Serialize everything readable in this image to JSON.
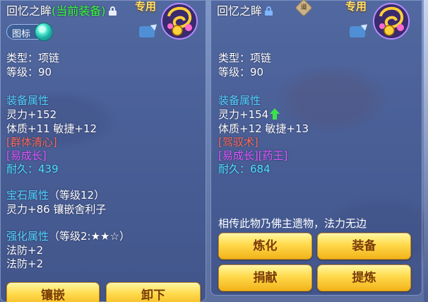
{
  "left": {
    "name": "回忆之眸",
    "current_tag": "(当前装备)",
    "exclusive": "专用",
    "icon_toggle_label": "图标",
    "type": "类型：项链",
    "level": "等级：90",
    "attr_header": "装备属性",
    "attr_lines": [
      "灵力+152",
      "体质+11 敏捷+12"
    ],
    "special": "[群体清心]",
    "effect": "[易成长]",
    "durability": "耐久：439",
    "gem_header": "宝石属性",
    "gem_level": "（等级12）",
    "gem_line": "灵力+86 镶嵌舍利子",
    "enhance_header": "强化属性",
    "enhance_level": "（等级2:★★☆）",
    "enhance_lines": [
      "法防+2",
      "法防+2"
    ],
    "buttons": [
      "镶嵌",
      "卸下"
    ]
  },
  "right": {
    "name": "回忆之眸",
    "seal_label": "谶",
    "exclusive": "专用",
    "type": "类型：项链",
    "level": "等级：90",
    "attr_header": "装备属性",
    "attr_lines": [
      "灵力+154",
      "体质+12 敏捷+13"
    ],
    "special": "[驾驭术]",
    "effect": "[易成长][药王]",
    "durability": "耐久：684",
    "description": "相传此物乃佛主遗物，法力无边",
    "buttons": [
      "炼化",
      "装备",
      "捐献",
      "提炼"
    ]
  },
  "colors": {
    "panel": "#465c96",
    "section": "#55d3ff",
    "special": "#ff6c5a",
    "effect": "#e157ff",
    "durability": "#4fe0ff",
    "current_equip": "#35ff3c",
    "button": "#ffd94a",
    "button_text": "#7a3b08"
  },
  "icons": [
    "lock-icon",
    "share-icon",
    "necklace-icon",
    "toggle-knob-icon",
    "arrow-up-icon",
    "seal-icon"
  ]
}
